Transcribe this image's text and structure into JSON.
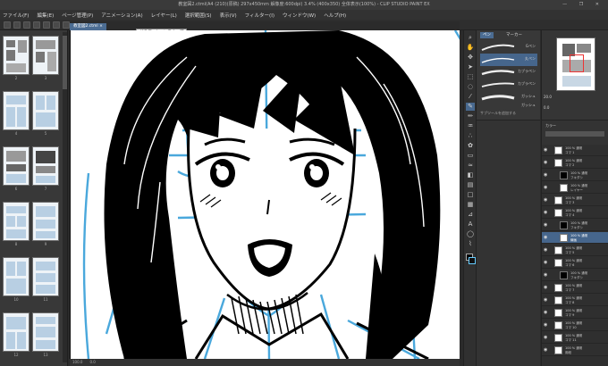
{
  "window": {
    "title": "教室図2.ctml(A4 (210)(原稿) 297x450mm 解像度:600dpi) 3.4% (400x350) 全体表示(100%) - CLIP STUDIO PAINT EX",
    "controls": "— ❐ ✕"
  },
  "menu": [
    "ファイル(F)",
    "編集(E)",
    "ページ管理(P)",
    "アニメーション(A)",
    "レイヤー(L)",
    "選択範囲(S)",
    "表示(V)",
    "フィルター(I)",
    "ウィンドウ(W)",
    "ヘルプ(H)"
  ],
  "tooltip": "グラデーションスナップ",
  "document_tab": "教室図2.ctml ×",
  "page_numbers": [
    "2",
    "3",
    "4",
    "5",
    "6",
    "7",
    "8",
    "9",
    "10",
    "11",
    "12",
    "13"
  ],
  "subtool": {
    "tabs": [
      "ペン",
      "マーカー"
    ],
    "brushes": [
      "Gペン",
      "丸ペン",
      "カブラペン",
      "カブラペン",
      "ガッシュ",
      "ガッシュ"
    ],
    "add_label": "サブツールを追加する"
  },
  "navigator": {
    "zoom": "20.0",
    "angle": "0.0"
  },
  "color_panel": {
    "label": "カラー"
  },
  "layers": [
    {
      "name": "100 % 通常",
      "sub": "コマ 1",
      "selected": false
    },
    {
      "name": "100 % 通常",
      "sub": "コマ 2",
      "selected": false
    },
    {
      "name": "100 % 通常",
      "sub": "フキダシ",
      "selected": false
    },
    {
      "name": "100 % 通常",
      "sub": "レイヤー",
      "selected": false
    },
    {
      "name": "100 % 通常",
      "sub": "コマ 3",
      "selected": false
    },
    {
      "name": "100 % 通常",
      "sub": "コマ 4",
      "selected": false
    },
    {
      "name": "100 % 通常",
      "sub": "フキダシ",
      "selected": false
    },
    {
      "name": "100 % 通常",
      "sub": "線画",
      "selected": true
    },
    {
      "name": "100 % 通常",
      "sub": "コマ 5",
      "selected": false
    },
    {
      "name": "100 % 通常",
      "sub": "コマ 6",
      "selected": false
    },
    {
      "name": "100 % 通常",
      "sub": "フキダシ",
      "selected": false
    },
    {
      "name": "100 % 通常",
      "sub": "コマ 7",
      "selected": false
    },
    {
      "name": "100 % 通常",
      "sub": "コマ 8",
      "selected": false
    },
    {
      "name": "100 % 通常",
      "sub": "コマ 9",
      "selected": false
    },
    {
      "name": "100 % 通常",
      "sub": "コマ 10",
      "selected": false
    },
    {
      "name": "100 % 通常",
      "sub": "コマ 11",
      "selected": false
    },
    {
      "name": "100 % 通常",
      "sub": "用紙",
      "selected": false
    }
  ],
  "status": {
    "zoom": "100.0",
    "angle": "0.0"
  },
  "colors": {
    "accent": "#4b6c92",
    "sketch_blue": "#4aa8dc",
    "ink": "#000000"
  }
}
